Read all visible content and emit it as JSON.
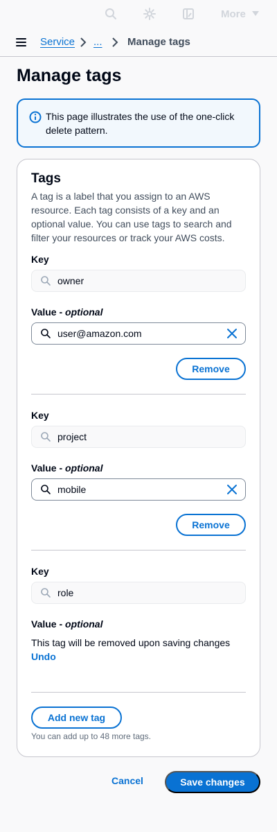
{
  "top_nav": {
    "more_label": "More",
    "icons": [
      "search-icon",
      "settings-icon",
      "layout-icon"
    ],
    "icon_color": "#d1d5db"
  },
  "breadcrumb": {
    "items": [
      "Service",
      "..."
    ],
    "current": "Manage tags"
  },
  "page_title": "Manage tags",
  "alert": {
    "text": "This page illustrates the use of the one-click delete pattern."
  },
  "tags": {
    "title": "Tags",
    "description": "A tag is a label that you assign to an AWS resource. Each tag consists of a key and an optional value. You can use tags to search and filter your resources or track your AWS costs.",
    "key_label": "Key",
    "value_label": "Value",
    "optional_label": "optional",
    "remove_label": "Remove",
    "items": [
      {
        "key": "owner",
        "value": "user@amazon.com"
      },
      {
        "key": "project",
        "value": "mobile"
      },
      {
        "key": "role"
      }
    ],
    "removed_note": "This tag will be removed upon saving changes",
    "undo_label": "Undo",
    "add_label": "Add new tag",
    "hint": "You can add up to 48 more tags."
  },
  "footer": {
    "cancel_label": "Cancel",
    "save_label": "Save changes"
  },
  "colors": {
    "primary": "#0972d3",
    "text": "#000716",
    "info_bg": "#f2f8fd",
    "border": "#c6c6cd"
  }
}
